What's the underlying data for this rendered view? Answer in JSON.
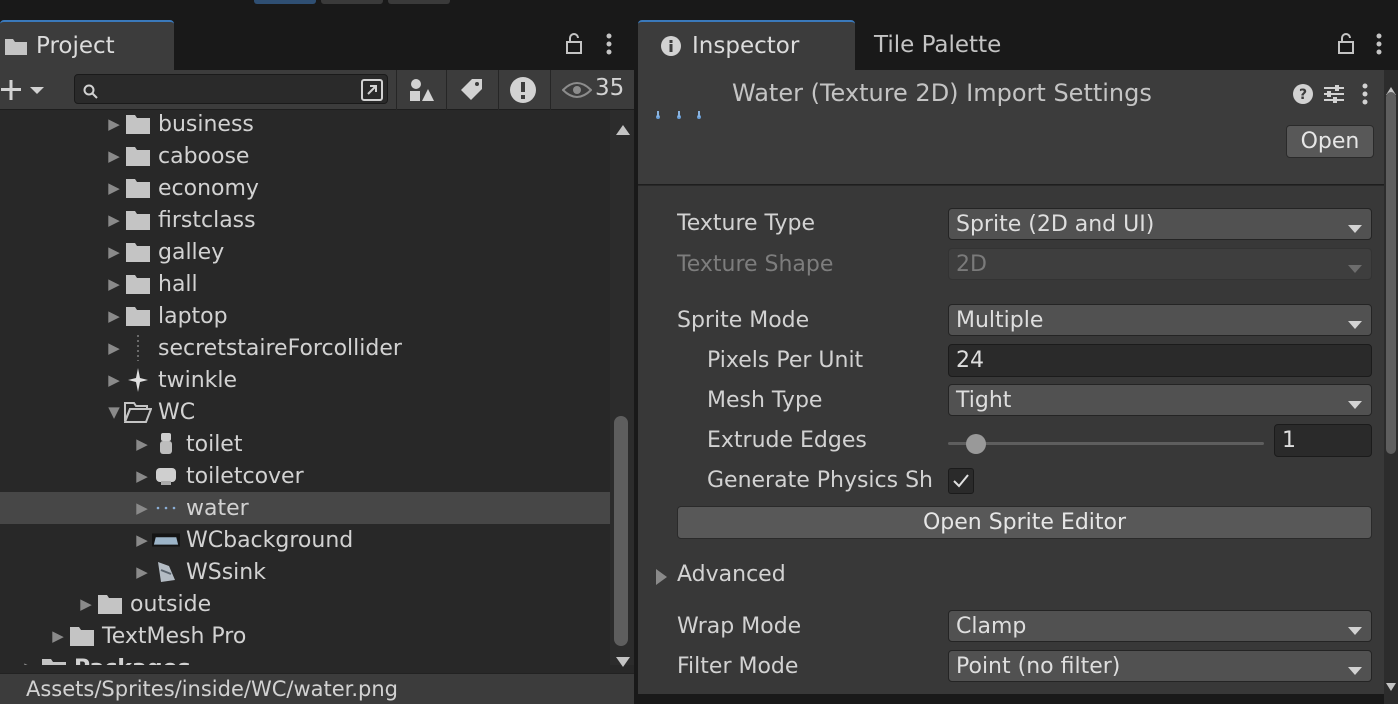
{
  "project_panel": {
    "tab_label": "Project",
    "visible_count": "35",
    "search": {
      "value": "",
      "placeholder": ""
    },
    "tree": [
      {
        "label": "business",
        "icon": "folder-icon",
        "depth": 2,
        "expanded": false,
        "bold": false
      },
      {
        "label": "caboose",
        "icon": "folder-icon",
        "depth": 2,
        "expanded": false,
        "bold": false
      },
      {
        "label": "economy",
        "icon": "folder-icon",
        "depth": 2,
        "expanded": false,
        "bold": false
      },
      {
        "label": "firstclass",
        "icon": "folder-icon",
        "depth": 2,
        "expanded": false,
        "bold": false
      },
      {
        "label": "galley",
        "icon": "folder-icon",
        "depth": 2,
        "expanded": false,
        "bold": false
      },
      {
        "label": "hall",
        "icon": "folder-icon",
        "depth": 2,
        "expanded": false,
        "bold": false
      },
      {
        "label": "laptop",
        "icon": "folder-icon",
        "depth": 2,
        "expanded": false,
        "bold": false
      },
      {
        "label": "secretstaireForcollider",
        "icon": "sprite-dotted-icon",
        "depth": 2,
        "expanded": false,
        "bold": false
      },
      {
        "label": "twinkle",
        "icon": "sprite-twinkle-icon",
        "depth": 2,
        "expanded": false,
        "bold": false
      },
      {
        "label": "WC",
        "icon": "folder-open-icon",
        "depth": 2,
        "expanded": true,
        "bold": false
      },
      {
        "label": "toilet",
        "icon": "sprite-toilet-icon",
        "depth": 3,
        "expanded": false,
        "bold": false
      },
      {
        "label": "toiletcover",
        "icon": "sprite-toiletcover-icon",
        "depth": 3,
        "expanded": false,
        "bold": false
      },
      {
        "label": "water",
        "icon": "sprite-water-icon",
        "depth": 3,
        "expanded": false,
        "bold": false,
        "selected": true
      },
      {
        "label": "WCbackground",
        "icon": "sprite-background-icon",
        "depth": 3,
        "expanded": false,
        "bold": false
      },
      {
        "label": "WSsink",
        "icon": "sprite-sink-icon",
        "depth": 3,
        "expanded": false,
        "bold": false
      },
      {
        "label": "outside",
        "icon": "folder-icon",
        "depth": 1,
        "expanded": false,
        "bold": false
      },
      {
        "label": "TextMesh Pro",
        "icon": "folder-icon",
        "depth": 0,
        "expanded": false,
        "bold": false
      },
      {
        "label": "Packages",
        "icon": "folder-icon",
        "depth": -1,
        "expanded": false,
        "bold": true
      }
    ],
    "status_path": "Assets/Sprites/inside/WC/water.png"
  },
  "inspector": {
    "tabs": [
      "Inspector",
      "Tile Palette"
    ],
    "header_title": "Water (Texture 2D) Import Settings",
    "open_button": "Open",
    "fields": {
      "texture_type": {
        "label": "Texture Type",
        "value": "Sprite (2D and UI)"
      },
      "texture_shape": {
        "label": "Texture Shape",
        "value": "2D"
      },
      "sprite_mode": {
        "label": "Sprite Mode",
        "value": "Multiple"
      },
      "pixels_per_unit": {
        "label": "Pixels Per Unit",
        "value": "24"
      },
      "mesh_type": {
        "label": "Mesh Type",
        "value": "Tight"
      },
      "extrude_edges": {
        "label": "Extrude Edges",
        "value": "1",
        "slider_fraction": 0.06
      },
      "generate_physics": {
        "label": "Generate Physics Sh",
        "checked": true
      },
      "wrap_mode": {
        "label": "Wrap Mode",
        "value": "Clamp"
      },
      "filter_mode": {
        "label": "Filter Mode",
        "value": "Point (no filter)"
      }
    },
    "open_sprite_editor": "Open Sprite Editor",
    "advanced_label": "Advanced"
  },
  "colors": {
    "accent": "#3a79bb",
    "panel_bg": "#282828",
    "inspector_bg": "#383838",
    "selection": "#474747"
  }
}
